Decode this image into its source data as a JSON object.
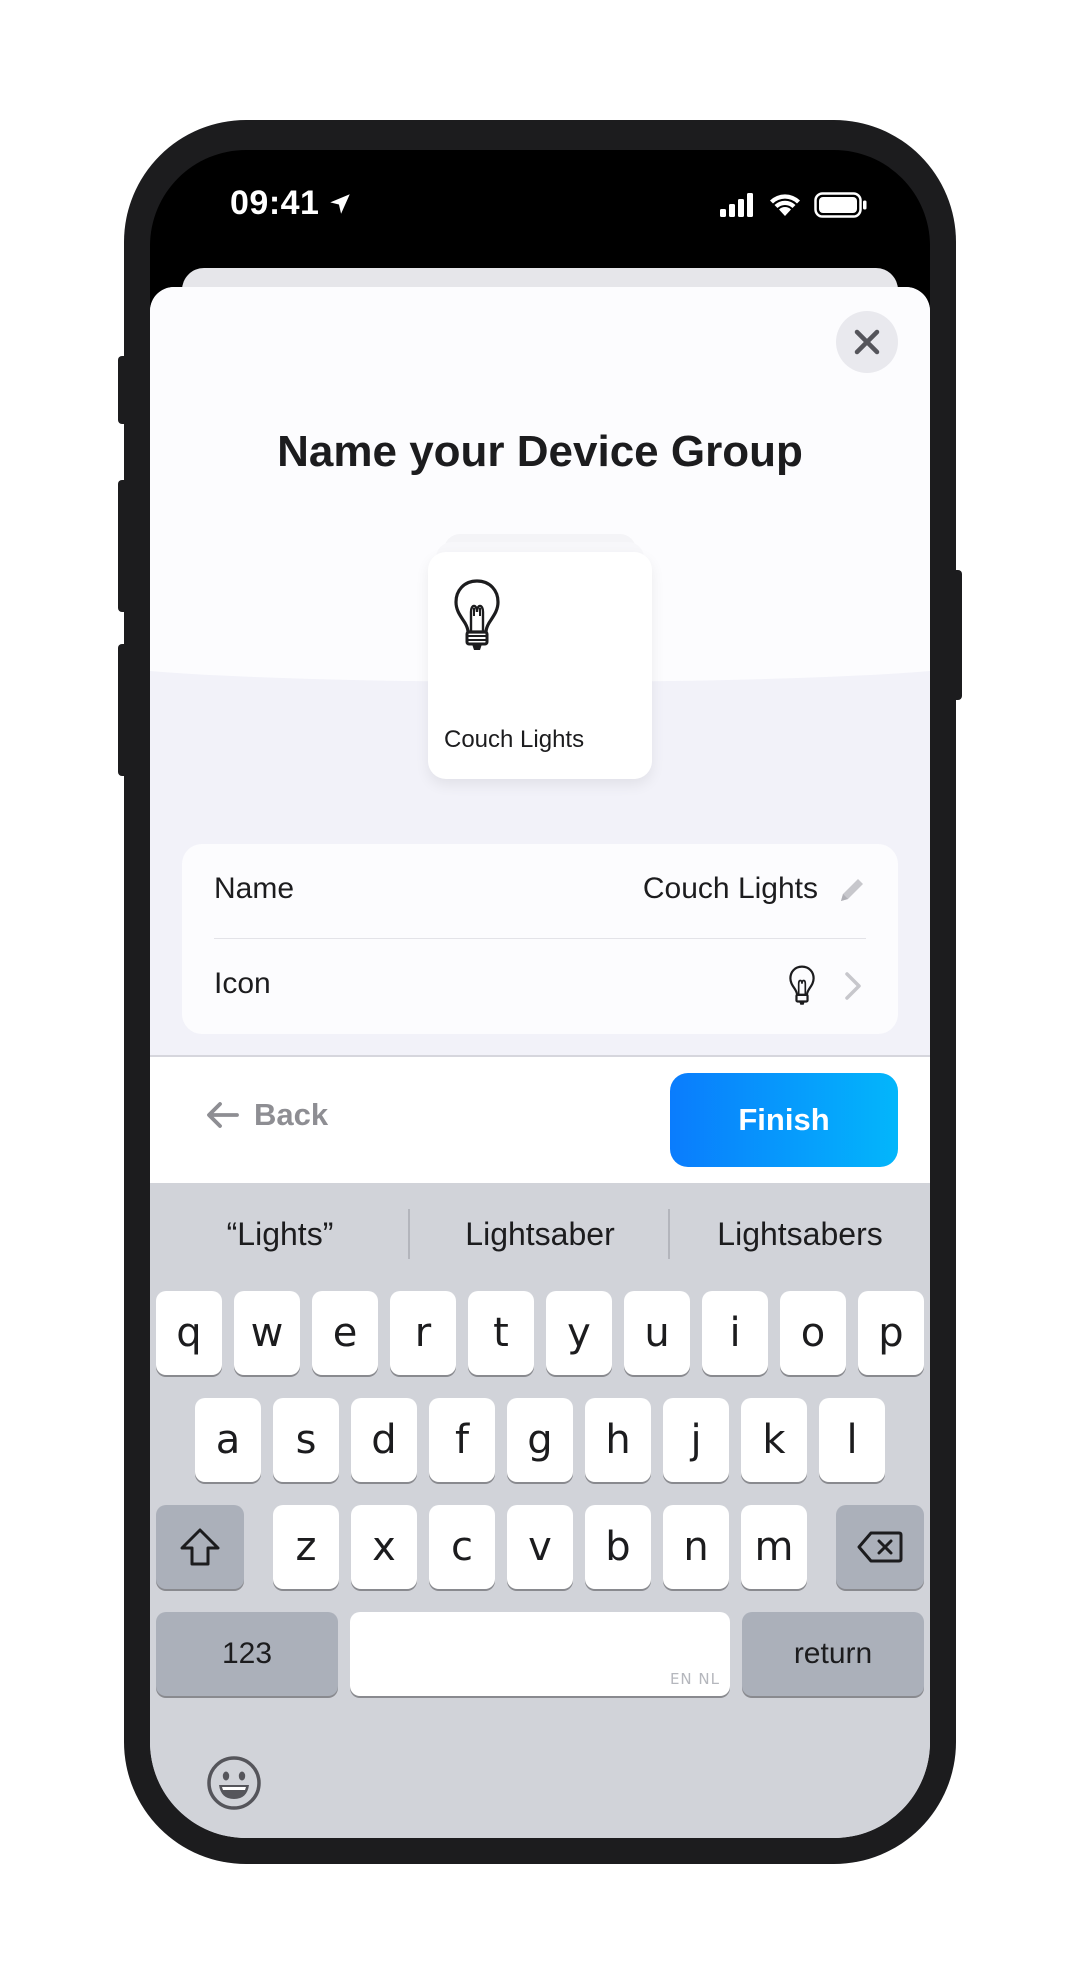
{
  "status_bar": {
    "time": "09:41"
  },
  "sheet": {
    "title": "Name your Device Group",
    "group_card": {
      "label": "Couch Lights",
      "icon": "light-bulb-icon"
    }
  },
  "settings": {
    "name": {
      "label": "Name",
      "value": "Couch Lights",
      "action_icon": "pencil-icon"
    },
    "icon": {
      "label": "Icon",
      "value_icon": "light-bulb-icon",
      "action_icon": "chevron-right-icon"
    }
  },
  "footer": {
    "back_label": "Back",
    "finish_label": "Finish"
  },
  "colors": {
    "finish_gradient_start": "#0a7cfd",
    "finish_gradient_end": "#03b6fb",
    "keyboard_bg": "#d1d3d9"
  },
  "keyboard": {
    "suggestions": [
      "“Lights”",
      "Lightsaber",
      "Lightsabers"
    ],
    "row1": [
      "q",
      "w",
      "e",
      "r",
      "t",
      "y",
      "u",
      "i",
      "o",
      "p"
    ],
    "row2": [
      "a",
      "s",
      "d",
      "f",
      "g",
      "h",
      "j",
      "k",
      "l"
    ],
    "row3": [
      "z",
      "x",
      "c",
      "v",
      "b",
      "n",
      "m"
    ],
    "numbers_label": "123",
    "return_label": "return",
    "space_hint": "EN NL"
  }
}
